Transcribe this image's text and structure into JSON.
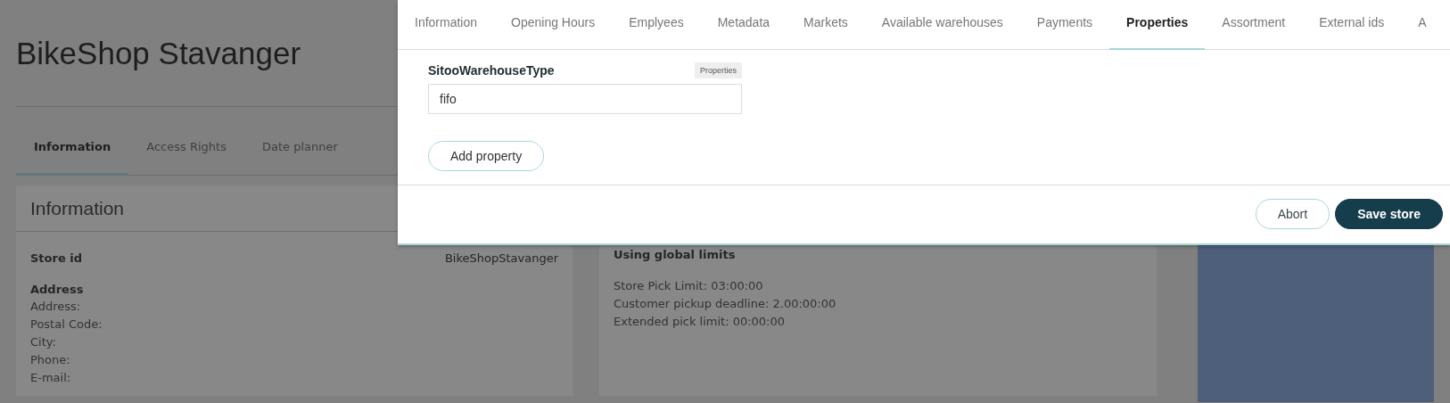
{
  "page": {
    "title": "BikeShop Stavanger",
    "tabs": [
      {
        "label": "Information",
        "selected": true
      },
      {
        "label": "Access Rights",
        "selected": false
      },
      {
        "label": "Date planner",
        "selected": false
      }
    ],
    "info_card": {
      "heading": "Information",
      "store_id_label": "Store id",
      "store_id_value": "BikeShopStavanger",
      "address_heading": "Address",
      "fields": [
        "Address:",
        "Postal Code:",
        "City:",
        "Phone:",
        "E-mail:"
      ]
    },
    "limits_card": {
      "heading": "Using global limits",
      "lines": [
        "Store Pick Limit: 03:00:00",
        "Customer pickup deadline: 2.00:00:00",
        "Extended pick limit: 00:00:00"
      ]
    }
  },
  "modal": {
    "tabs": [
      {
        "label": "Information",
        "selected": false
      },
      {
        "label": "Opening Hours",
        "selected": false
      },
      {
        "label": "Emplyees",
        "selected": false
      },
      {
        "label": "Metadata",
        "selected": false
      },
      {
        "label": "Markets",
        "selected": false
      },
      {
        "label": "Available warehouses",
        "selected": false
      },
      {
        "label": "Payments",
        "selected": false
      },
      {
        "label": "Properties",
        "selected": true
      },
      {
        "label": "Assortment",
        "selected": false
      },
      {
        "label": "External ids",
        "selected": false
      },
      {
        "label": "A",
        "selected": false
      }
    ],
    "property": {
      "name": "SitooWarehouseType",
      "badge": "Properties",
      "value": "fifo"
    },
    "add_button": "Add property",
    "buttons": [
      {
        "label": "Abort",
        "kind": "secondary"
      },
      {
        "label": "Save store",
        "kind": "primary"
      }
    ]
  }
}
